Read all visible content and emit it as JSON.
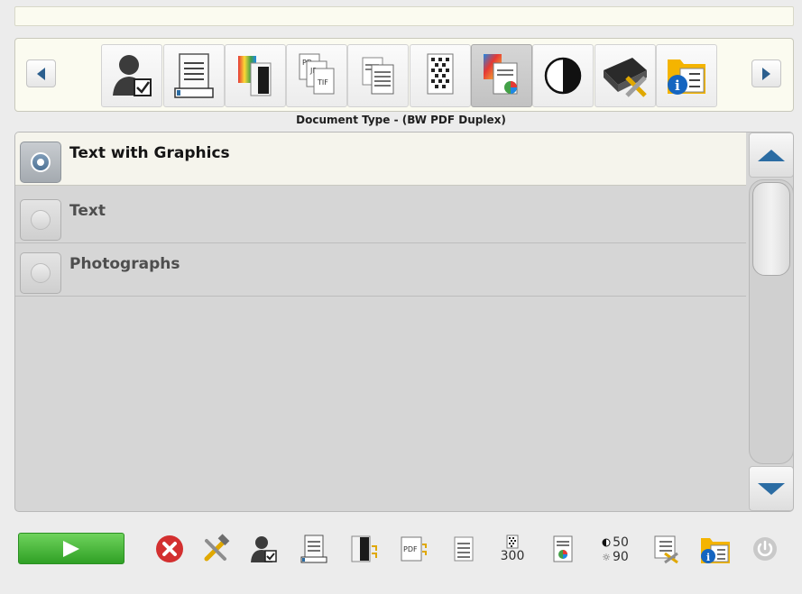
{
  "section_title": "Document Type - (BW PDF Duplex)",
  "toolbar": {
    "buttons": [
      {
        "icon": "scan-profile-icon",
        "active": false
      },
      {
        "icon": "document-feeder-icon",
        "active": false
      },
      {
        "icon": "color-pages-icon",
        "active": false
      },
      {
        "icon": "file-format-icon",
        "active": false
      },
      {
        "icon": "duplex-pages-icon",
        "active": false
      },
      {
        "icon": "resolution-icon",
        "active": false
      },
      {
        "icon": "document-type-icon",
        "active": true
      },
      {
        "icon": "contrast-icon",
        "active": false
      },
      {
        "icon": "scanner-settings-icon",
        "active": false
      },
      {
        "icon": "info-folder-icon",
        "active": false
      }
    ]
  },
  "options": [
    {
      "label": "Text with Graphics",
      "selected": true
    },
    {
      "label": "Text",
      "selected": false
    },
    {
      "label": "Photographs",
      "selected": false
    }
  ],
  "bottom": {
    "resolution_value": "300",
    "contrast_value": "50",
    "brightness_value": "90"
  },
  "colors": {
    "accent_blue": "#2b6ca3",
    "go_green": "#2fa025",
    "cancel_red": "#d32f2f",
    "selected_row": "#f5f4ec"
  }
}
